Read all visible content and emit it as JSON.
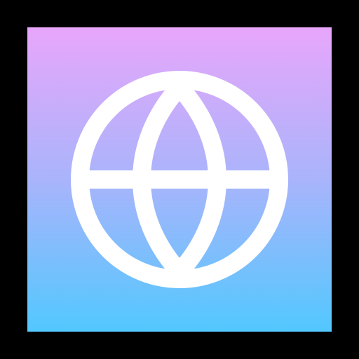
{
  "icon": {
    "name": "globe-icon",
    "glyph_color": "#ffffff",
    "background_gradient": {
      "top": "#e8a6fb",
      "middle": "#a9b4fb",
      "bottom": "#52c8fe"
    },
    "frame_color": "#000000"
  }
}
